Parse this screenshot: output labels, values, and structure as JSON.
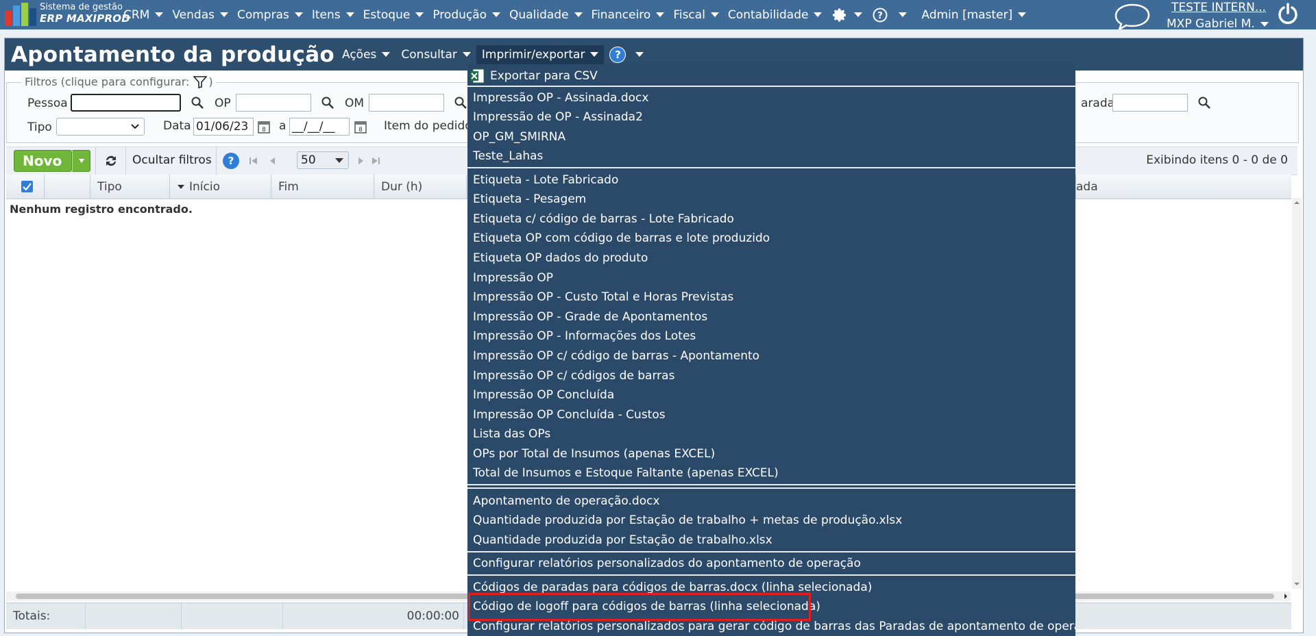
{
  "topbar": {
    "logo_line1": "Sistema de gestão",
    "logo_line2": "ERP MAXIPROD",
    "menu": [
      "CRM",
      "Vendas",
      "Compras",
      "Itens",
      "Estoque",
      "Produção",
      "Qualidade",
      "Financeiro",
      "Fiscal",
      "Contabilidade"
    ],
    "admin_label": "Admin [master]",
    "company": "TESTE INTERN...",
    "user": "MXP Gabriel M."
  },
  "page": {
    "title": "Apontamento da produção",
    "menu": {
      "acoes": "Ações",
      "consultar": "Consultar",
      "imprimir": "Imprimir/exportar"
    }
  },
  "filters": {
    "legend": "Filtros (clique para configurar:",
    "legend_close": ")",
    "pessoa_label": "Pessoa",
    "op_label": "OP",
    "om_label": "OM",
    "parada_label": "arada",
    "tipo_label": "Tipo",
    "data_label": "Data",
    "data_from": "01/06/23",
    "a_label": "a",
    "data_to": "__/__/__",
    "item_pedido_label": "Item do pedido"
  },
  "toolbar": {
    "new_label": "Novo",
    "hide_filters_label": "Ocultar filtros",
    "page_size": "50",
    "item_count": "Exibindo itens 0 - 0 de 0"
  },
  "grid": {
    "columns": [
      "Tipo",
      "Início",
      "Fim",
      "Dur (h)"
    ],
    "partial_column": "ada",
    "empty_message": "Nenhum registro encontrado.",
    "totals_label": "Totais:",
    "totals_duration": "00:00:00"
  },
  "dropdown": {
    "csv_label": "Exportar para CSV",
    "group1": [
      "Impressão OP - Assinada.docx",
      "Impressão de OP - Assinada2",
      "OP_GM_SMIRNA",
      "Teste_Lahas"
    ],
    "group2": [
      "Etiqueta - Lote Fabricado",
      "Etiqueta - Pesagem",
      "Etiqueta c/ código de barras - Lote Fabricado",
      "Etiqueta OP com código de barras e lote produzido",
      "Etiqueta OP dados do produto",
      "Impressão OP",
      "Impressão OP - Custo Total e Horas Previstas",
      "Impressão OP - Grade de Apontamentos",
      "Impressão OP - Informações dos Lotes",
      "Impressão OP c/ código de barras - Apontamento",
      "Impressão OP c/ códigos de barras",
      "Impressão OP Concluída",
      "Impressão OP Concluída - Custos",
      "Lista das OPs",
      "OPs por Total de Insumos (apenas EXCEL)",
      "Total de Insumos e Estoque Faltante (apenas EXCEL)"
    ],
    "group3": [
      "Apontamento de operação.docx",
      "Quantidade produzida por Estação de trabalho + metas de produção.xlsx",
      "Quantidade produzida por Estação de trabalho.xlsx"
    ],
    "configure_reports": "Configurar relatórios personalizados do apontamento de operação",
    "group5": [
      "Códigos de paradas para códigos de barras.docx (linha selecionada)",
      "Código de logoff para códigos de barras (linha selecionada)",
      "Configurar relatórios personalizados para gerar código de barras das Paradas de apontamento de operação"
    ]
  },
  "colors": {
    "topbar": "#3e6b98",
    "titlebar": "#2e4e6e",
    "dropdown_bg": "#2b4a69",
    "new_button": "#6fb63a",
    "highlight": "#e21e1e"
  },
  "icons": [
    "logo-icon",
    "gear-icon",
    "help-icon",
    "chat-icon",
    "power-icon",
    "filter-icon",
    "search-icon",
    "calendar-icon",
    "refresh-icon",
    "first-page-icon",
    "prev-page-icon",
    "next-page-icon",
    "last-page-icon",
    "excel-icon"
  ]
}
